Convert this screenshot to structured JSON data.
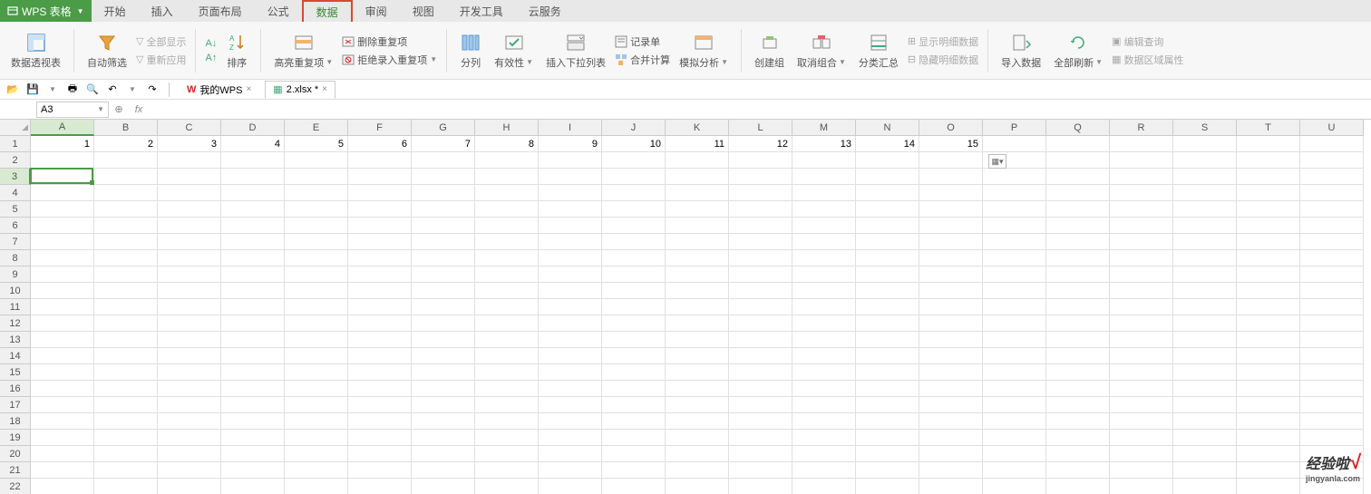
{
  "app": {
    "name": "WPS 表格"
  },
  "menu": {
    "tabs": [
      "开始",
      "插入",
      "页面布局",
      "公式",
      "数据",
      "审阅",
      "视图",
      "开发工具",
      "云服务"
    ],
    "active_index": 4
  },
  "ribbon": {
    "pivot": "数据透视表",
    "autofilter": "自动筛选",
    "show_all": "全部显示",
    "reapply": "重新应用",
    "sort": "排序",
    "highlight_dup": "高亮重复项",
    "remove_dup": "删除重复项",
    "reject_dup": "拒绝录入重复项",
    "text_to_col": "分列",
    "validation": "有效性",
    "dropdown": "插入下拉列表",
    "record_form": "记录单",
    "consolidate": "合并计算",
    "whatif": "模拟分析",
    "group": "创建组",
    "ungroup": "取消组合",
    "subtotal": "分类汇总",
    "show_detail": "显示明细数据",
    "hide_detail": "隐藏明细数据",
    "import": "导入数据",
    "refresh_all": "全部刷新",
    "edit_query": "编辑查询",
    "range_prop": "数据区域属性"
  },
  "doc_tabs": {
    "wps": "我的WPS",
    "file": "2.xlsx *"
  },
  "formula_bar": {
    "cell_ref": "A3",
    "fx": "fx"
  },
  "grid": {
    "columns": [
      "A",
      "B",
      "C",
      "D",
      "E",
      "F",
      "G",
      "H",
      "I",
      "J",
      "K",
      "L",
      "M",
      "N",
      "O",
      "P",
      "Q",
      "R",
      "S",
      "T",
      "U"
    ],
    "row_count": 22,
    "row1": [
      "1",
      "2",
      "3",
      "4",
      "5",
      "6",
      "7",
      "8",
      "9",
      "10",
      "11",
      "12",
      "13",
      "14",
      "15"
    ],
    "active": {
      "row": 3,
      "col": 0
    }
  },
  "watermark": {
    "main": "经验啦",
    "sub": "jingyanla.com"
  }
}
